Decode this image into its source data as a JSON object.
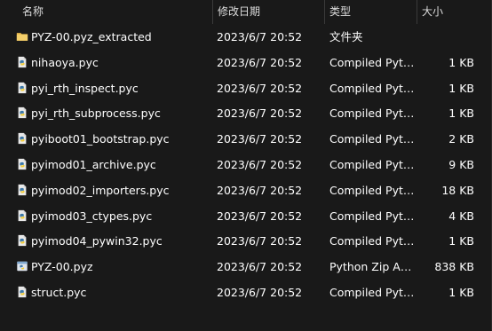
{
  "columns": {
    "name": "名称",
    "date": "修改日期",
    "type": "类型",
    "size": "大小"
  },
  "sort_indicator": "^",
  "files": [
    {
      "name": "PYZ-00.pyz_extracted",
      "date": "2023/6/7 20:52",
      "type": "文件夹",
      "size": "",
      "icon": "folder-icon"
    },
    {
      "name": "nihaoya.pyc",
      "date": "2023/6/7 20:52",
      "type": "Compiled Pytho...",
      "size": "1 KB",
      "icon": "python-file-icon"
    },
    {
      "name": "pyi_rth_inspect.pyc",
      "date": "2023/6/7 20:52",
      "type": "Compiled Pytho...",
      "size": "1 KB",
      "icon": "python-file-icon"
    },
    {
      "name": "pyi_rth_subprocess.pyc",
      "date": "2023/6/7 20:52",
      "type": "Compiled Pytho...",
      "size": "1 KB",
      "icon": "python-file-icon"
    },
    {
      "name": "pyiboot01_bootstrap.pyc",
      "date": "2023/6/7 20:52",
      "type": "Compiled Pytho...",
      "size": "2 KB",
      "icon": "python-file-icon"
    },
    {
      "name": "pyimod01_archive.pyc",
      "date": "2023/6/7 20:52",
      "type": "Compiled Pytho...",
      "size": "9 KB",
      "icon": "python-file-icon"
    },
    {
      "name": "pyimod02_importers.pyc",
      "date": "2023/6/7 20:52",
      "type": "Compiled Pytho...",
      "size": "18 KB",
      "icon": "python-file-icon"
    },
    {
      "name": "pyimod03_ctypes.pyc",
      "date": "2023/6/7 20:52",
      "type": "Compiled Pytho...",
      "size": "4 KB",
      "icon": "python-file-icon"
    },
    {
      "name": "pyimod04_pywin32.pyc",
      "date": "2023/6/7 20:52",
      "type": "Compiled Pytho...",
      "size": "1 KB",
      "icon": "python-file-icon"
    },
    {
      "name": "PYZ-00.pyz",
      "date": "2023/6/7 20:52",
      "type": "Python Zip Appli...",
      "size": "838 KB",
      "icon": "python-zip-icon"
    },
    {
      "name": "struct.pyc",
      "date": "2023/6/7 20:52",
      "type": "Compiled Pytho...",
      "size": "1 KB",
      "icon": "python-file-icon"
    }
  ],
  "colors": {
    "background": "#191919",
    "text": "#ffffff",
    "header_text": "#dcdcdc",
    "folder": "#e8b84a",
    "python_blue": "#3b77a8",
    "python_yellow": "#f2cc3a"
  }
}
